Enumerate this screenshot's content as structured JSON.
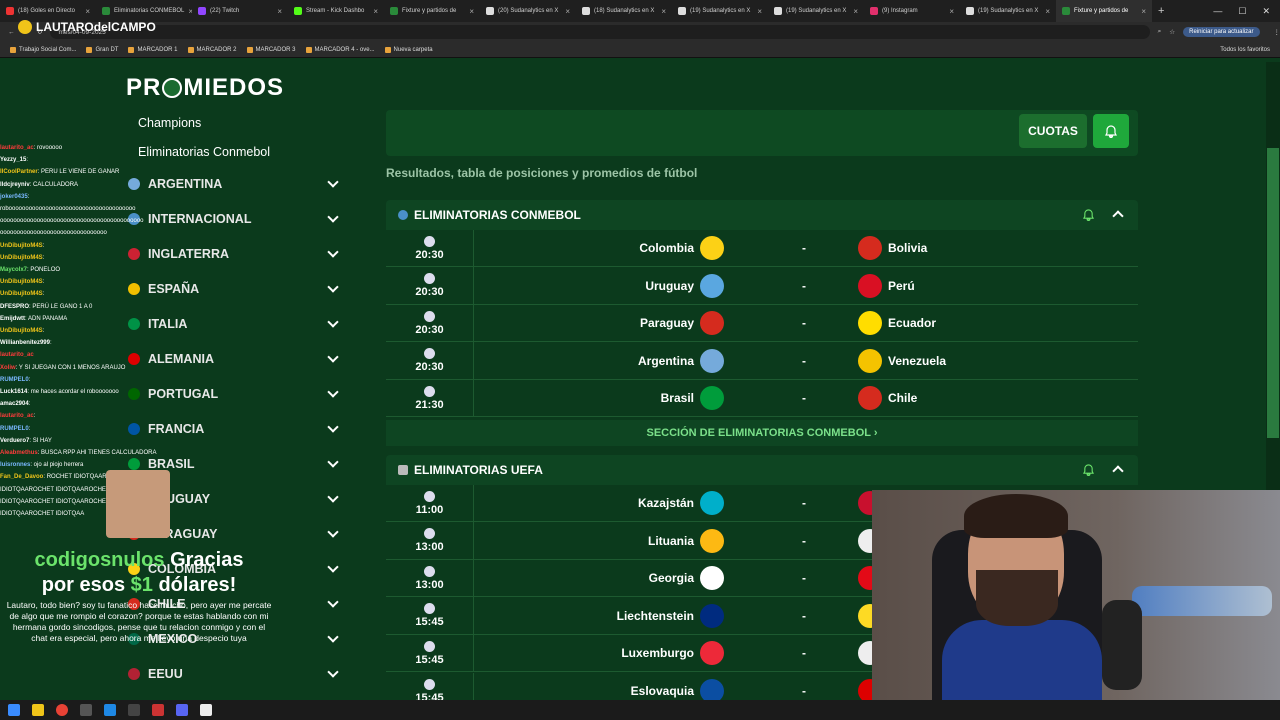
{
  "browser": {
    "tabs": [
      {
        "label": "(18) Goles en Directo",
        "color": "#e33"
      },
      {
        "label": "Eliminatorias CONMEBOL",
        "color": "#2a8a3a"
      },
      {
        "label": "(22) Twitch",
        "color": "#9146ff"
      },
      {
        "label": "Stream - Kick Dashbo",
        "color": "#53fc18"
      },
      {
        "label": "Fixture y partidos de",
        "color": "#2a8a3a"
      },
      {
        "label": "(20) Sudanalytics en X",
        "color": "#ddd"
      },
      {
        "label": "(18) Sudanalytics en X",
        "color": "#ddd"
      },
      {
        "label": "(19) Sudanalytics en X",
        "color": "#ddd"
      },
      {
        "label": "(19) Sudanalytics en X",
        "color": "#ddd"
      },
      {
        "label": "(9) Instagram",
        "color": "#e1306c"
      },
      {
        "label": "(19) Sudanalytics en X",
        "color": "#ddd"
      },
      {
        "label": "Fixture y partidos de",
        "color": "#2a8a3a",
        "active": true
      }
    ],
    "url": "mes/04-09-2025",
    "update_button": "Reiniciar para actualizar",
    "bookmarks": [
      "Trabajo Social Com...",
      "Gran DT",
      "MARCADOR 1",
      "MARCADOR 2",
      "MARCADOR 3",
      "MARCADOR 4 - ove...",
      "Nueva carpeta"
    ],
    "bookmarks_right": "Todos los favoritos"
  },
  "overlay": {
    "streamer_name": "LAUTAROdelCAMPO",
    "donation_user": "codigosnulos",
    "donation_line1_rest": " Gracias",
    "donation_line2_pre": "por esos ",
    "donation_amount": "$1",
    "donation_line2_post": " dólares!",
    "donation_message": "Lautaro, todo bien? soy tu fanatico hace mucho, pero ayer me percate de algo que me rompio el corazon? porque te estas hablando con mi hermana gordo sincodigos, pense que tu relacion conmigo y con el chat era especial, pero ahora me llevo una despecio tuya",
    "chat": [
      {
        "user": "lautarito_ac",
        "text": ": rovooooo",
        "color": "#ff3b3b"
      },
      {
        "user": "Yezzy_15",
        "text": ":",
        "color": "#fff"
      },
      {
        "user": "IICoolPartner",
        "text": ": PERU LE VIENE DE GANAR",
        "color": "#f0c419"
      },
      {
        "user": "lldcjreyniv",
        "text": ": CALCULADORA",
        "color": "#fff"
      },
      {
        "user": "joker0435",
        "text": ":",
        "color": "#7ab8ff"
      },
      {
        "user": "",
        "text": "roboooooooooooooooooooooooooooooooooooooo",
        "color": "#fff"
      },
      {
        "user": "",
        "text": "ooooooooooooooooooooooooooooooooooooooooooo",
        "color": "#fff"
      },
      {
        "user": "",
        "text": "oooooooooooooooooooooooooooooooo",
        "color": "#fff"
      },
      {
        "user": "UnDibujitoM4S",
        "text": ":",
        "color": "#f0c419"
      },
      {
        "user": "UnDibujitoM4S",
        "text": ":",
        "color": "#f0c419"
      },
      {
        "user": "Maycolx7",
        "text": ": PONELOO",
        "color": "#6be36b"
      },
      {
        "user": "UnDibujitoM4S",
        "text": ":",
        "color": "#f0c419"
      },
      {
        "user": "UnDibujitoM4S",
        "text": ":",
        "color": "#f0c419"
      },
      {
        "user": "DFESPRO",
        "text": ": PERÚ LE GANO 1 A 0",
        "color": "#fff"
      },
      {
        "user": "Emijdwtt",
        "text": ": ADN PANAMA",
        "color": "#fff"
      },
      {
        "user": "UnDibujitoM4S",
        "text": ":",
        "color": "#f0c419"
      },
      {
        "user": "Willianbenitez999",
        "text": ":",
        "color": "#fff"
      },
      {
        "user": "lautarito_ac",
        "text": "",
        "color": "#ff3b3b"
      },
      {
        "user": "Xoliw",
        "text": ": Y SI JUEGAN CON 1 MENOS ARAUJO",
        "color": "#ff3b3b"
      },
      {
        "user": "RUMPEL0",
        "text": ":",
        "color": "#7ab8ff"
      },
      {
        "user": "Luck1614",
        "text": ": me haces acordar el robooooooo",
        "color": "#fff"
      },
      {
        "user": "amac2904",
        "text": ":",
        "color": "#fff"
      },
      {
        "user": "lautarito_ac",
        "text": ":",
        "color": "#ff3b3b"
      },
      {
        "user": "RUMPEL0",
        "text": ":",
        "color": "#7ab8ff"
      },
      {
        "user": "Verduero7",
        "text": ": SI HAY",
        "color": "#fff"
      },
      {
        "user": "Aleabmethus",
        "text": ": BUSCA RPP AHI TIENES CALCULADORA",
        "color": "#ff3b3b"
      },
      {
        "user": "luisronnes",
        "text": ": ojo al piojo herrera",
        "color": "#7ab8ff"
      },
      {
        "user": "Fan_De_Davoo",
        "text": ": ROCHET IDIOTQAAROCHET",
        "color": "#f0c419"
      },
      {
        "user": "",
        "text": "IDIOTQAAROCHET IDIOTQAAROCHET",
        "color": "#fff"
      },
      {
        "user": "",
        "text": "IDIOTQAAROCHET IDIOTQAAROCHET",
        "color": "#fff"
      },
      {
        "user": "",
        "text": "IDIOTQAAROCHET IDIOTQAA",
        "color": "#fff"
      }
    ]
  },
  "site": {
    "logo_pre": "PR",
    "logo_post": "MIEDOS",
    "top_links": [
      "Champions",
      "Eliminatorias Conmebol"
    ],
    "sidebar": [
      {
        "label": "ARGENTINA",
        "flag": "#75aadb"
      },
      {
        "label": "INTERNACIONAL",
        "flag": "#4a90c8"
      },
      {
        "label": "INGLATERRA",
        "flag": "#cc2233"
      },
      {
        "label": "ESPAÑA",
        "flag": "#f1bf00"
      },
      {
        "label": "ITALIA",
        "flag": "#009246"
      },
      {
        "label": "ALEMANIA",
        "flag": "#dd0000"
      },
      {
        "label": "PORTUGAL",
        "flag": "#006600"
      },
      {
        "label": "FRANCIA",
        "flag": "#0055a4"
      },
      {
        "label": "BRASIL",
        "flag": "#009c3b"
      },
      {
        "label": "URUGUAY",
        "flag": "#5aa7e0"
      },
      {
        "label": "PARAGUAY",
        "flag": "#d52b1e"
      },
      {
        "label": "COLOMBIA",
        "flag": "#fcd116"
      },
      {
        "label": "CHILE",
        "flag": "#d52b1e"
      },
      {
        "label": "MEXICO",
        "flag": "#006847"
      },
      {
        "label": "EEUU",
        "flag": "#b22234"
      }
    ],
    "cuotas_button": "CUOTAS",
    "subtitle": "Resultados, tabla de posiciones y promedios de fútbol",
    "sections": [
      {
        "title": "ELIMINATORIAS CONMEBOL",
        "link": "SECCIÓN DE ELIMINATORIAS CONMEBOL ›",
        "matches": [
          {
            "time": "20:30",
            "home": "Colombia",
            "home_flag": "#fcd116",
            "away": "Bolivia",
            "away_flag": "#d52b1e",
            "sep": "-"
          },
          {
            "time": "20:30",
            "home": "Uruguay",
            "home_flag": "#5aa7e0",
            "away": "Perú",
            "away_flag": "#d91023",
            "sep": "-"
          },
          {
            "time": "20:30",
            "home": "Paraguay",
            "home_flag": "#d52b1e",
            "away": "Ecuador",
            "away_flag": "#ffdd00",
            "sep": "-"
          },
          {
            "time": "20:30",
            "home": "Argentina",
            "home_flag": "#75aadb",
            "away": "Venezuela",
            "away_flag": "#f4c300",
            "sep": "-"
          },
          {
            "time": "21:30",
            "home": "Brasil",
            "home_flag": "#009c3b",
            "away": "Chile",
            "away_flag": "#d52b1e",
            "sep": "-"
          }
        ]
      },
      {
        "title": "ELIMINATORIAS UEFA",
        "matches": [
          {
            "time": "11:00",
            "home": "Kazajstán",
            "home_flag": "#00afca",
            "away": "",
            "away_flag": "#c8102e",
            "sep": "-"
          },
          {
            "time": "13:00",
            "home": "Lituania",
            "home_flag": "#fdb913",
            "away": "",
            "away_flag": "#eee",
            "sep": "-"
          },
          {
            "time": "13:00",
            "home": "Georgia",
            "home_flag": "#ffffff",
            "away": "",
            "away_flag": "#e30a17",
            "sep": "-"
          },
          {
            "time": "15:45",
            "home": "Liechtenstein",
            "home_flag": "#002b7f",
            "away": "",
            "away_flag": "#fdda24",
            "sep": "-"
          },
          {
            "time": "15:45",
            "home": "Luxemburgo",
            "home_flag": "#ed2939",
            "away": "",
            "away_flag": "#eee",
            "sep": "-"
          },
          {
            "time": "15:45",
            "home": "Eslovaquia",
            "home_flag": "#0b4ea2",
            "away": "",
            "away_flag": "#dd0000",
            "sep": "-"
          }
        ]
      }
    ]
  }
}
